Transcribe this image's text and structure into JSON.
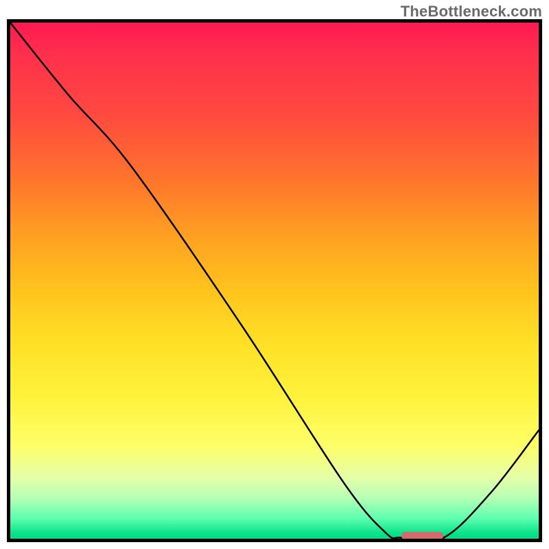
{
  "watermark": "TheBottleneck.com",
  "chart_data": {
    "type": "line",
    "title": "",
    "xlabel": "",
    "ylabel": "",
    "xlim": [
      0,
      100
    ],
    "ylim": [
      0,
      100
    ],
    "grid": false,
    "legend": false,
    "curve_points": [
      {
        "x": 0.0,
        "y": 100.0
      },
      {
        "x": 11.0,
        "y": 86.0
      },
      {
        "x": 23.0,
        "y": 72.0
      },
      {
        "x": 44.0,
        "y": 41.0
      },
      {
        "x": 63.0,
        "y": 11.0
      },
      {
        "x": 71.0,
        "y": 1.2
      },
      {
        "x": 74.0,
        "y": 0.2
      },
      {
        "x": 82.0,
        "y": 0.2
      },
      {
        "x": 91.0,
        "y": 9.0
      },
      {
        "x": 100.0,
        "y": 21.0
      }
    ],
    "marker": {
      "x_start": 74.0,
      "x_end": 82.0,
      "y": 0.5
    },
    "gradient_description": "vertical red→orange→yellow→pale-yellow→green",
    "marker_color": "#d46a6a"
  }
}
